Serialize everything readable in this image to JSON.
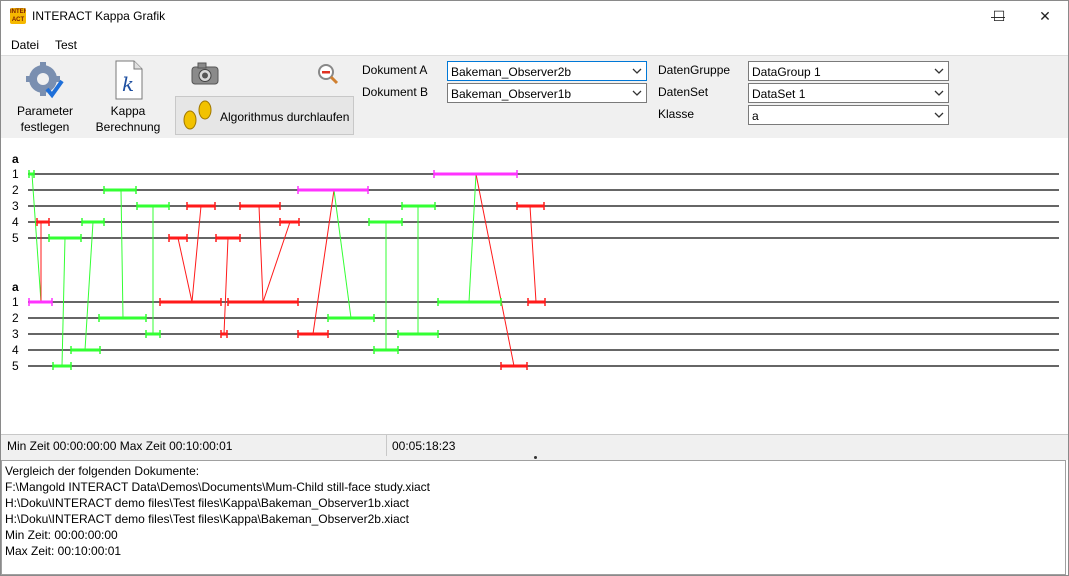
{
  "window": {
    "title": "INTERACT Kappa Grafik",
    "app_icon_text": "INTER ACT",
    "minimize_glyph": "—",
    "maximize_glyph": "☐",
    "close_glyph": "✕"
  },
  "menu": {
    "items": [
      "Datei",
      "Test"
    ]
  },
  "toolbar": {
    "parameter_label_1": "Parameter",
    "parameter_label_2": "festlegen",
    "kappa_label_1": "Kappa",
    "kappa_label_2": "Berechnung",
    "algorithm_label": "Algorithmus durchlaufen",
    "dokument_a_label": "Dokument A",
    "dokument_a_value": "Bakeman_Observer2b",
    "dokument_b_label": "Dokument B",
    "dokument_b_value": "Bakeman_Observer1b",
    "datengruppe_label": "DatenGruppe",
    "datengruppe_value": "DataGroup 1",
    "datenset_label": "DatenSet",
    "datenset_value": "DataSet 1",
    "klasse_label": "Klasse",
    "klasse_value": "a"
  },
  "graph": {
    "top_class": "a",
    "bottom_class": "a",
    "row_labels": [
      "1",
      "2",
      "3",
      "4",
      "5"
    ],
    "colors": {
      "match": "#33ff33",
      "mismatch": "#ff1a1a",
      "extra": "#ff33ff",
      "baseline": "#666666"
    }
  },
  "status": {
    "min_max": "Min Zeit 00:00:00:00  Max Zeit 00:10:00:01",
    "cursor_time": "00:05:18:23"
  },
  "output": {
    "lines": [
      "Vergleich der folgenden Dokumente:",
      "F:\\Mangold INTERACT Data\\Demos\\Documents\\Mum-Child still-face study.xiact",
      "H:\\Doku\\INTERACT demo files\\Test files\\Kappa\\Bakeman_Observer1b.xiact",
      "H:\\Doku\\INTERACT demo files\\Test files\\Kappa\\Bakeman_Observer2b.xiact",
      "Min Zeit: 00:00:00:00",
      "Max Zeit: 00:10:00:01"
    ]
  }
}
